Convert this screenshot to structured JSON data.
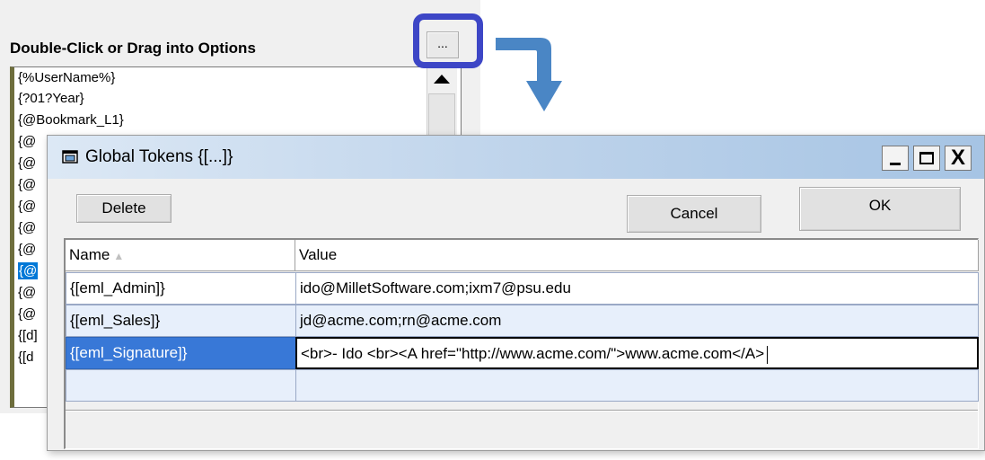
{
  "background_panel": {
    "title": "Double-Click or Drag into Options",
    "ellipsis_button_label": "...",
    "list_items": [
      "{%UserName%}",
      "{?01?Year}",
      "{@Bookmark_L1}",
      "{@",
      "{@",
      "{@",
      "{@",
      "{@",
      "{@",
      "{@",
      "{@",
      "{@",
      "{[d]",
      "{[d"
    ],
    "selected_index": 9
  },
  "dialog": {
    "title": "Global Tokens {[...]}",
    "window_controls": {
      "minimize": "_",
      "maximize": "□",
      "close": "X"
    },
    "buttons": {
      "delete": "Delete",
      "cancel": "Cancel",
      "ok": "OK"
    },
    "grid": {
      "columns": [
        "Name",
        "Value"
      ],
      "sort_indicator": "▲",
      "rows": [
        {
          "name": "{[eml_Admin]}",
          "value": "ido@MilletSoftware.com;ixm7@psu.edu"
        },
        {
          "name": "{[eml_Sales]}",
          "value": "jd@acme.com;rn@acme.com"
        },
        {
          "name": "{[eml_Signature]}",
          "value": "<br>- Ido <br><A href=\"http://www.acme.com/\">www.acme.com</A>"
        },
        {
          "name": "",
          "value": ""
        }
      ],
      "selected_row": 2
    }
  },
  "colors": {
    "highlight_box": "#3d46c6",
    "arrow": "#4a86c5",
    "selection": "#3878d7",
    "alt_row": "#e7effb"
  }
}
